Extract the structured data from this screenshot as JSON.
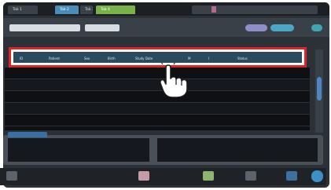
{
  "tabs": [
    {
      "label": "Tab 1"
    },
    {
      "label": "Tab 2"
    },
    {
      "label": "Tab 3"
    },
    {
      "label": "Tab 4"
    }
  ],
  "toolbar": {
    "search_field": "",
    "filter_field": "",
    "button_1": "",
    "button_2": ""
  },
  "table": {
    "headers": [
      "ID",
      "Patient",
      "Sex",
      "Birth",
      "Study Date",
      "M",
      "I",
      "Status"
    ],
    "rows": [
      [
        "",
        "",
        "",
        "",
        "",
        "",
        "",
        ""
      ],
      [
        "",
        "",
        "",
        "",
        "",
        "",
        "",
        ""
      ],
      [
        "",
        "",
        "",
        "",
        "",
        "",
        "",
        ""
      ],
      [
        "",
        "",
        "",
        "",
        "",
        "",
        "",
        ""
      ],
      [
        "",
        "",
        "",
        "",
        "",
        "",
        "",
        ""
      ]
    ]
  },
  "info_panel": {
    "tag_label": "",
    "left_line_1": "",
    "left_line_2": "",
    "right_line_1": "",
    "right_line_2": ""
  },
  "bottom": {
    "left_button": "",
    "button_a": "",
    "button_b": "",
    "button_c": "",
    "button_d": ""
  },
  "colors": {
    "highlight": "#e02222",
    "header_bg": "#2a4a5e",
    "accent_blue": "#4e86c4"
  },
  "icons": [
    "hand-pointer-icon"
  ]
}
